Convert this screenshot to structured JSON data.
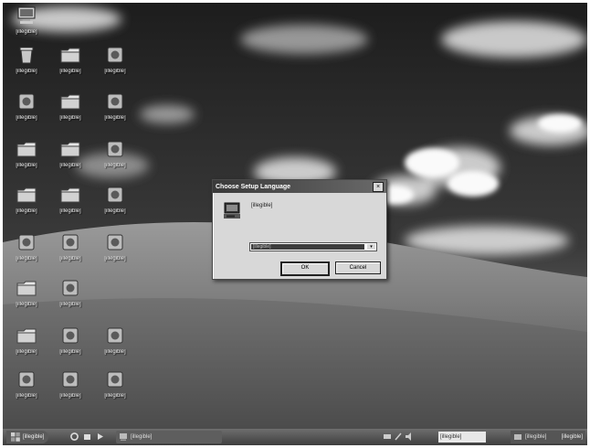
{
  "desktop": {
    "wallpaper": "rolling green hill with blue sky and scattered white clouds",
    "icons": [
      {
        "name": "desktop-icon-my-computer",
        "icon": "computer-icon",
        "label": "[illegible]"
      },
      {
        "name": "desktop-icon-r1c1",
        "icon": "recycle-bin-icon",
        "label": "[illegible]"
      },
      {
        "name": "desktop-icon-r1c2",
        "icon": "folder-icon",
        "label": "[illegible]"
      },
      {
        "name": "desktop-icon-r1c3",
        "icon": "app-icon",
        "label": "[illegible]"
      },
      {
        "name": "desktop-icon-r2c1",
        "icon": "app-icon",
        "label": "[illegible]"
      },
      {
        "name": "desktop-icon-r2c2",
        "icon": "folder-icon",
        "label": "[illegible]"
      },
      {
        "name": "desktop-icon-r2c3",
        "icon": "app-icon",
        "label": "[illegible]"
      },
      {
        "name": "desktop-icon-r3c1",
        "icon": "folder-icon",
        "label": "[illegible]"
      },
      {
        "name": "desktop-icon-r3c2",
        "icon": "folder-icon",
        "label": "[illegible]"
      },
      {
        "name": "desktop-icon-r3c3",
        "icon": "app-icon",
        "label": "[illegible]"
      },
      {
        "name": "desktop-icon-r4c1",
        "icon": "folder-icon",
        "label": "[illegible]"
      },
      {
        "name": "desktop-icon-r4c2",
        "icon": "folder-icon",
        "label": "[illegible]"
      },
      {
        "name": "desktop-icon-r4c3",
        "icon": "app-icon",
        "label": "[illegible]"
      },
      {
        "name": "desktop-icon-r5c1",
        "icon": "app-icon",
        "label": "[illegible]"
      },
      {
        "name": "desktop-icon-r5c2",
        "icon": "app-icon",
        "label": "[illegible]"
      },
      {
        "name": "desktop-icon-r5c3",
        "icon": "app-icon",
        "label": "[illegible]"
      },
      {
        "name": "desktop-icon-r6c1",
        "icon": "folder-icon",
        "label": "[illegible]"
      },
      {
        "name": "desktop-icon-r6c2",
        "icon": "app-icon",
        "label": "[illegible]"
      },
      {
        "name": "desktop-icon-r7c1",
        "icon": "folder-icon",
        "label": "[illegible]"
      },
      {
        "name": "desktop-icon-r7c2",
        "icon": "app-icon",
        "label": "[illegible]"
      },
      {
        "name": "desktop-icon-r7c3",
        "icon": "app-icon",
        "label": "[illegible]"
      },
      {
        "name": "desktop-icon-r8c1",
        "icon": "app-icon",
        "label": "[illegible]"
      },
      {
        "name": "desktop-icon-r8c2",
        "icon": "app-icon",
        "label": "[illegible]"
      },
      {
        "name": "desktop-icon-r8c3",
        "icon": "app-icon",
        "label": "[illegible]"
      }
    ]
  },
  "dialog": {
    "title": "Choose Setup Language",
    "close_label": "×",
    "message": "[illegible]",
    "language_value": "[illegible]",
    "ok_label": "OK",
    "cancel_label": "Cancel"
  },
  "taskbar": {
    "start_label": "[illegible]",
    "quick_launch": [
      "ie-icon",
      "explorer-icon",
      "media-icon"
    ],
    "task_button_label": "[illegible]",
    "ime_label": "[illegible]",
    "tray_label": "[illegible]",
    "clock": "[illegible]"
  }
}
